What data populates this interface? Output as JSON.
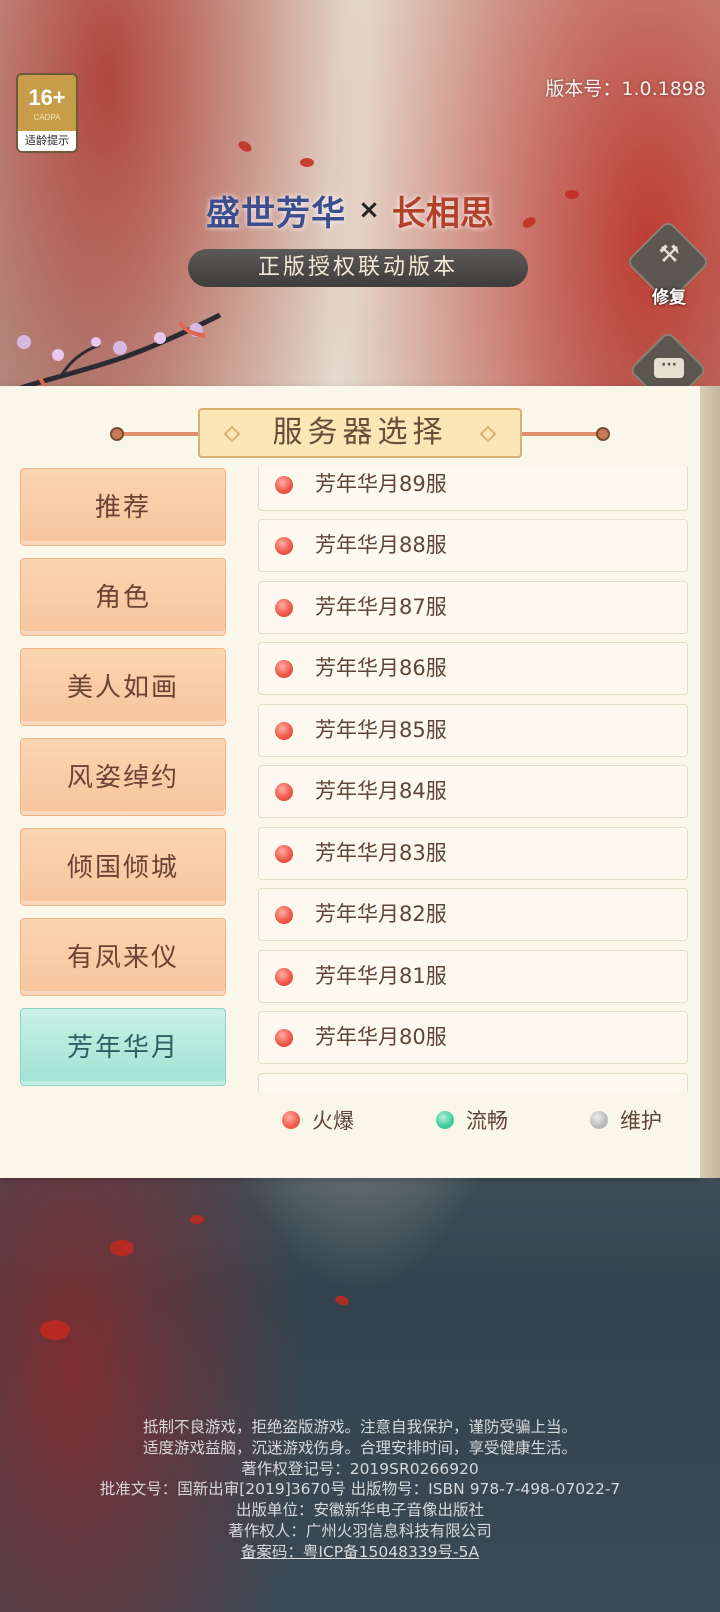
{
  "version_label": "版本号：1.0.1898",
  "age_badge": {
    "rating": "16+",
    "org": "CADPA",
    "tip": "适龄提示"
  },
  "logo": {
    "game_name": "盛世芳华",
    "separator": "×",
    "collab_name": "长相思",
    "subtitle": "正版授权联动版本"
  },
  "side_buttons": {
    "repair_label": "修复",
    "chat_icon": "chat-icon",
    "repair_icon": "tools-icon"
  },
  "panel": {
    "title": "服务器选择",
    "categories": [
      {
        "label": "推荐",
        "active": false
      },
      {
        "label": "角色",
        "active": false
      },
      {
        "label": "美人如画",
        "active": false
      },
      {
        "label": "风姿绰约",
        "active": false
      },
      {
        "label": "倾国倾城",
        "active": false
      },
      {
        "label": "有凤来仪",
        "active": false
      },
      {
        "label": "芳年华月",
        "active": true
      }
    ],
    "servers": [
      {
        "name": "芳年华月89服",
        "status": "火爆"
      },
      {
        "name": "芳年华月88服",
        "status": "火爆"
      },
      {
        "name": "芳年华月87服",
        "status": "火爆"
      },
      {
        "name": "芳年华月86服",
        "status": "火爆"
      },
      {
        "name": "芳年华月85服",
        "status": "火爆"
      },
      {
        "name": "芳年华月84服",
        "status": "火爆"
      },
      {
        "name": "芳年华月83服",
        "status": "火爆"
      },
      {
        "name": "芳年华月82服",
        "status": "火爆"
      },
      {
        "name": "芳年华月81服",
        "status": "火爆"
      },
      {
        "name": "芳年华月80服",
        "status": "火爆"
      }
    ],
    "legend": [
      {
        "label": "火爆",
        "color": "#f05a4b"
      },
      {
        "label": "流畅",
        "color": "#3cc99b"
      },
      {
        "label": "维护",
        "color": "#b9b9b9"
      }
    ]
  },
  "footer": {
    "lines": [
      "抵制不良游戏，拒绝盗版游戏。注意自我保护，谨防受骗上当。",
      "适度游戏益脑，沉迷游戏伤身。合理安排时间，享受健康生活。",
      "著作权登记号：2019SR0266920",
      "批准文号：国新出审[2019]3670号 出版物号：ISBN 978-7-498-07022-7",
      "出版单位：安徽新华电子音像出版社",
      "著作权人：广州火羽信息科技有限公司"
    ],
    "icp": "备案码：粤ICP备15048339号-5A"
  },
  "colors": {
    "active_tab": "#9ee2d3",
    "tab": "#f7c49d",
    "panel": "#fbf6ea",
    "hot": "#f05a4b"
  }
}
